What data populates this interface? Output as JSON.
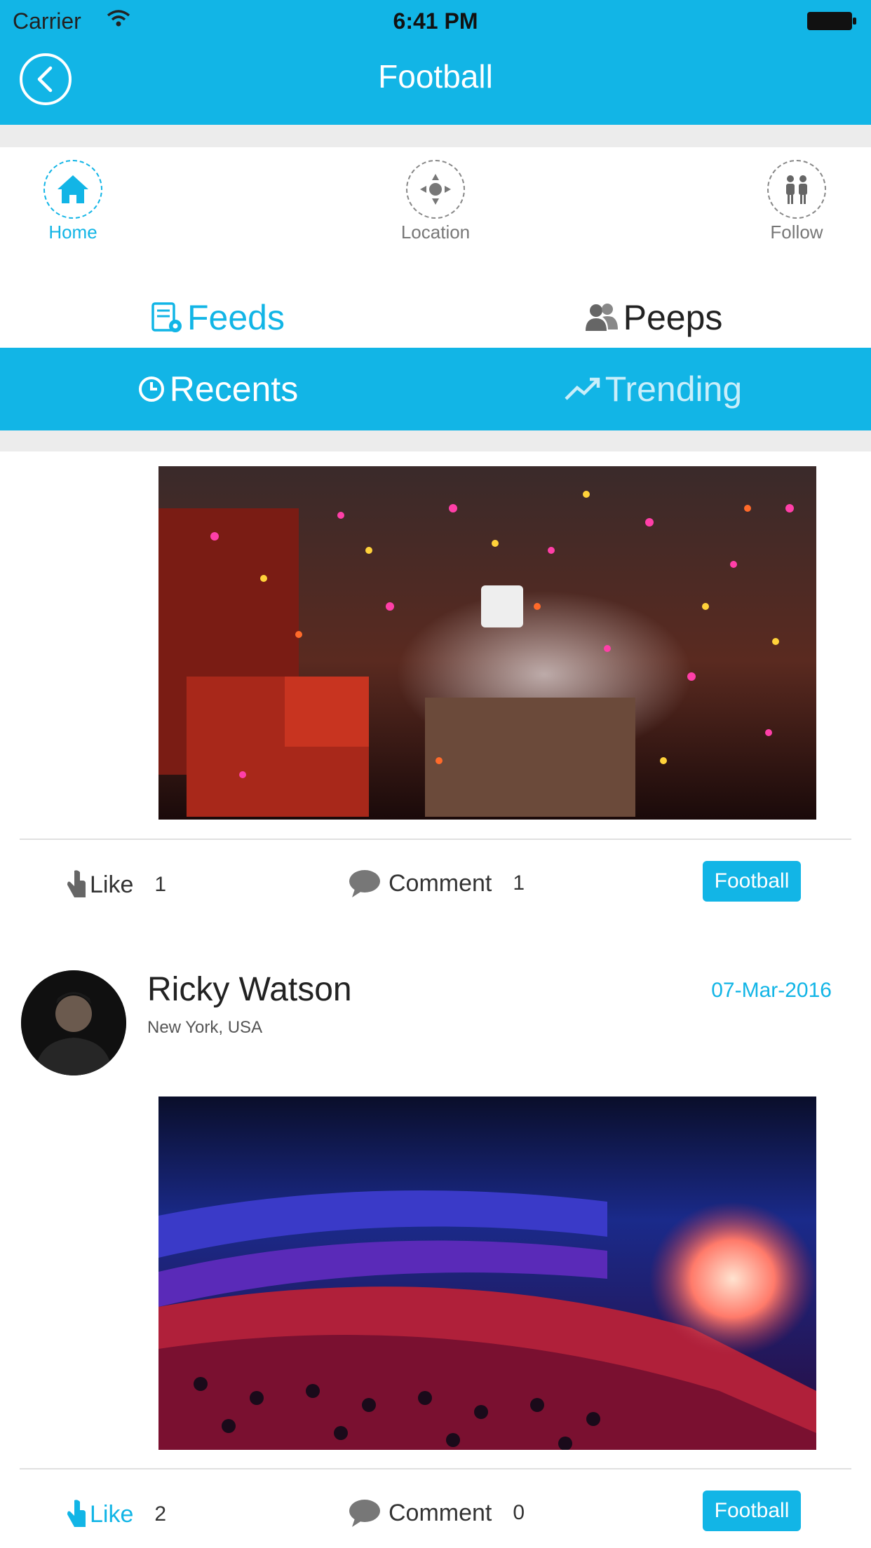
{
  "status_bar": {
    "carrier": "Carrier",
    "time": "6:41 PM"
  },
  "nav": {
    "title": "Football"
  },
  "icon_row": [
    {
      "label": "Home",
      "icon": "home-icon",
      "active": true
    },
    {
      "label": "Location",
      "icon": "location-icon",
      "active": false
    },
    {
      "label": "Follow",
      "icon": "follow-icon",
      "active": false
    }
  ],
  "tabs_primary": [
    {
      "label": "Feeds",
      "icon": "feeds-icon",
      "active": true
    },
    {
      "label": "Peeps",
      "icon": "peeps-icon",
      "active": false
    }
  ],
  "tabs_secondary": [
    {
      "label": "Recents",
      "icon": "clock-icon",
      "active": true
    },
    {
      "label": "Trending",
      "icon": "trending-icon",
      "active": false
    }
  ],
  "posts": [
    {
      "image": "confetti-stage-photo",
      "like_label": "Like",
      "like_count": "1",
      "comment_label": "Comment",
      "comment_count": "1",
      "tag": "Football"
    },
    {
      "author": "Ricky Watson",
      "location": "New York, USA",
      "date": "07-Mar-2016",
      "image": "theatre-concert-photo",
      "like_label": "Like",
      "like_count": "2",
      "comment_label": "Comment",
      "comment_count": "0",
      "tag": "Football"
    }
  ],
  "colors": {
    "accent": "#12b5e6",
    "divider": "#e0e0e0"
  }
}
